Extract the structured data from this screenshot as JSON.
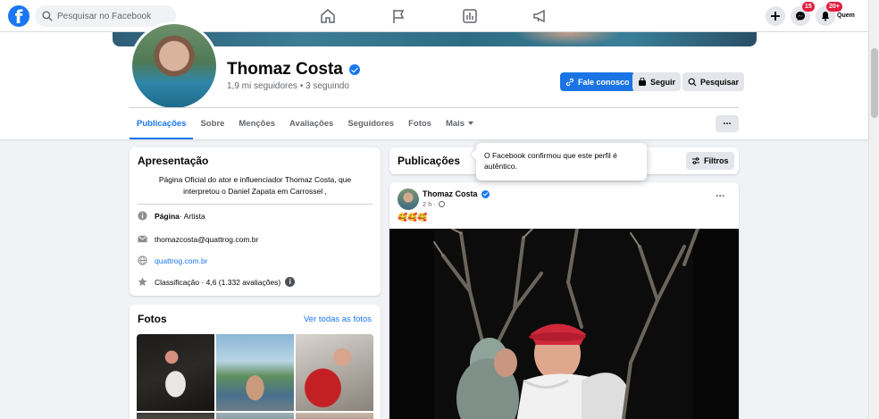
{
  "topbar": {
    "logo": "f",
    "search_placeholder": "Pesquisar no Facebook",
    "nav_icons": [
      "home-icon",
      "flag-icon",
      "chart-icon",
      "megaphone-icon"
    ],
    "messenger_badge": "15",
    "notifications_badge": "20+",
    "profile_label": "Quem"
  },
  "profile": {
    "name": "Thomaz Costa",
    "subtitle": "1,9 mi seguidores • 3 seguindo",
    "buttons": {
      "contact": "Fale conosco",
      "follow": "Seguir",
      "search": "Pesquisar"
    },
    "tabs": [
      {
        "label": "Publicações",
        "active": true
      },
      {
        "label": "Sobre"
      },
      {
        "label": "Menções"
      },
      {
        "label": "Avaliações"
      },
      {
        "label": "Seguidores"
      },
      {
        "label": "Fotos"
      },
      {
        "label": "Mais"
      }
    ],
    "more_button": "..."
  },
  "intro": {
    "title": "Apresentação",
    "bio": "Página Oficial do ator e influenciador Thomaz Costa, que interpretou o Daniel Zapata em Carrossel ,",
    "page_type_bold": "Página",
    "page_type_rest": " · Artista",
    "email": "thomazcosta@quattrog.com.br",
    "website": "quattrog.com.br",
    "rating": "Classificação · 4,6 (1.332 avaliações)",
    "rating_info": "i"
  },
  "photos": {
    "title": "Fotos",
    "see_all": "Ver todas as fotos"
  },
  "posts": {
    "title": "Publicações",
    "filters": "Filtros",
    "tooltip": "O Facebook confirmou que este perfil é autêntico."
  },
  "post": {
    "author": "Thomaz Costa",
    "time": "2 h ·",
    "text": "🥰🥰🥰",
    "menu": "···"
  },
  "colors": {
    "brand": "#1877f2",
    "badge": "#e41e3f",
    "background": "#f0f2f5"
  }
}
